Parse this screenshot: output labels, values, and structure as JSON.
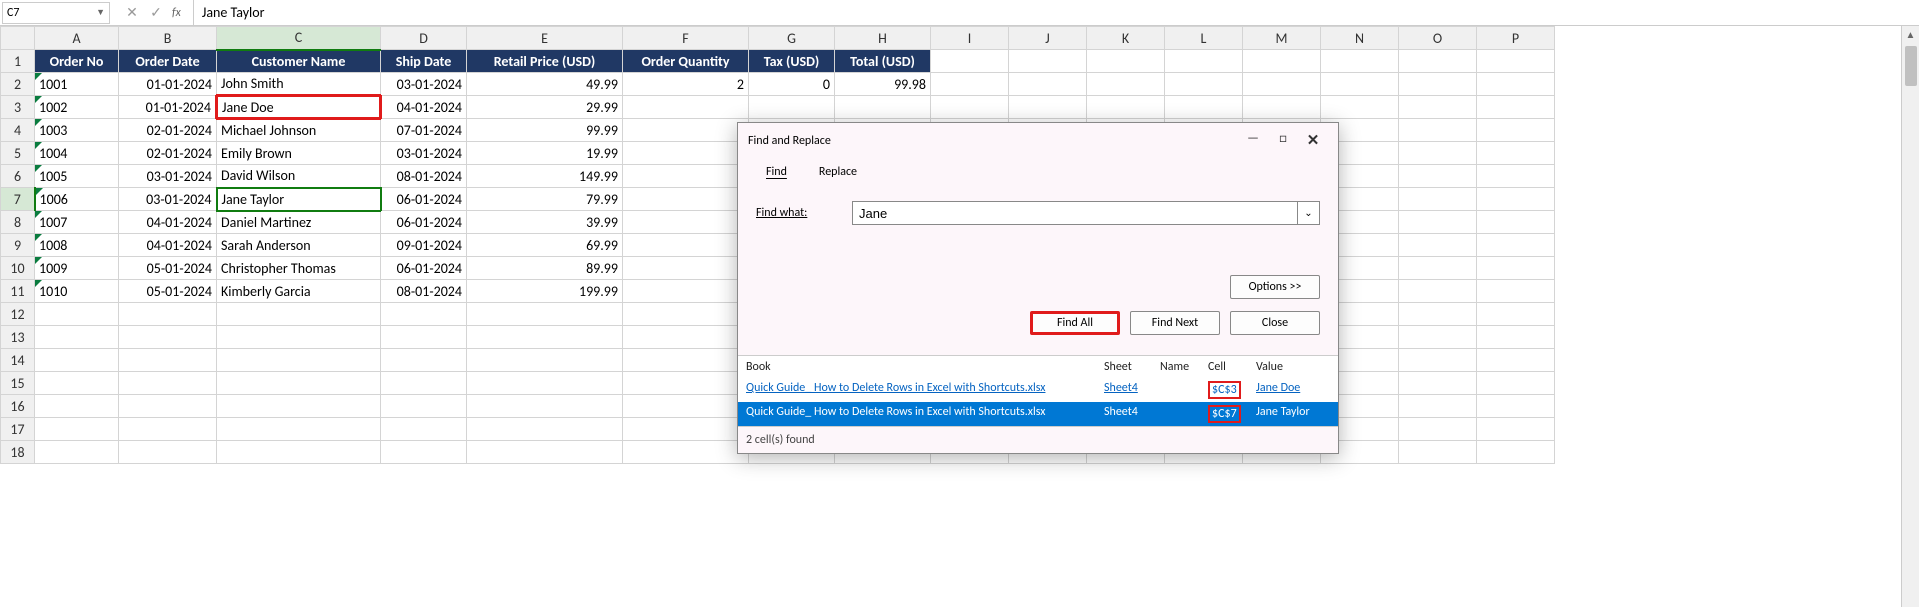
{
  "formula_bar": {
    "name_box": "C7",
    "cancel": "✕",
    "confirm": "✓",
    "fx": "fx",
    "content": "Jane Taylor"
  },
  "columns": [
    "A",
    "B",
    "C",
    "D",
    "E",
    "F",
    "G",
    "H",
    "I",
    "J",
    "K",
    "L",
    "M",
    "N",
    "O",
    "P"
  ],
  "row_numbers": [
    1,
    2,
    3,
    4,
    5,
    6,
    7,
    8,
    9,
    10,
    11,
    12,
    13,
    14,
    15,
    16,
    17,
    18
  ],
  "headers": [
    "Order No",
    "Order Date",
    "Customer Name",
    "Ship Date",
    "Retail Price (USD)",
    "Order Quantity",
    "Tax (USD)",
    "Total (USD)"
  ],
  "rows": [
    {
      "order_no": "1001",
      "order_date": "01-01-2024",
      "customer": "John Smith",
      "ship_date": "03-01-2024",
      "price": "49.99",
      "qty": "2",
      "tax": "0",
      "total": "99.98"
    },
    {
      "order_no": "1002",
      "order_date": "01-01-2024",
      "customer": "Jane Doe",
      "ship_date": "04-01-2024",
      "price": "29.99",
      "qty": "",
      "tax": "",
      "total": ""
    },
    {
      "order_no": "1003",
      "order_date": "02-01-2024",
      "customer": "Michael Johnson",
      "ship_date": "07-01-2024",
      "price": "99.99",
      "qty": "",
      "tax": "",
      "total": ""
    },
    {
      "order_no": "1004",
      "order_date": "02-01-2024",
      "customer": "Emily Brown",
      "ship_date": "03-01-2024",
      "price": "19.99",
      "qty": "",
      "tax": "",
      "total": ""
    },
    {
      "order_no": "1005",
      "order_date": "03-01-2024",
      "customer": "David Wilson",
      "ship_date": "08-01-2024",
      "price": "149.99",
      "qty": "",
      "tax": "",
      "total": ""
    },
    {
      "order_no": "1006",
      "order_date": "03-01-2024",
      "customer": "Jane Taylor",
      "ship_date": "06-01-2024",
      "price": "79.99",
      "qty": "",
      "tax": "",
      "total": ""
    },
    {
      "order_no": "1007",
      "order_date": "04-01-2024",
      "customer": "Daniel Martinez",
      "ship_date": "06-01-2024",
      "price": "39.99",
      "qty": "",
      "tax": "",
      "total": ""
    },
    {
      "order_no": "1008",
      "order_date": "04-01-2024",
      "customer": "Sarah Anderson",
      "ship_date": "09-01-2024",
      "price": "69.99",
      "qty": "",
      "tax": "",
      "total": ""
    },
    {
      "order_no": "1009",
      "order_date": "05-01-2024",
      "customer": "Christopher Thomas",
      "ship_date": "06-01-2024",
      "price": "89.99",
      "qty": "",
      "tax": "",
      "total": ""
    },
    {
      "order_no": "1010",
      "order_date": "05-01-2024",
      "customer": "Kimberly Garcia",
      "ship_date": "08-01-2024",
      "price": "199.99",
      "qty": "",
      "tax": "",
      "total": ""
    }
  ],
  "dialog": {
    "title": "Find and Replace",
    "tab_find": "Find",
    "tab_replace": "Replace",
    "find_what_label": "Find what:",
    "find_what_value": "Jane",
    "options_btn": "Options >>",
    "find_all_btn": "Find All",
    "find_next_btn": "Find Next",
    "close_btn": "Close",
    "results_headers": {
      "book": "Book",
      "sheet": "Sheet",
      "name": "Name",
      "cell": "Cell",
      "value": "Value"
    },
    "results": [
      {
        "book": "Quick Guide_ How to Delete Rows in Excel with Shortcuts.xlsx",
        "sheet": "Sheet4",
        "name": "",
        "cell": "$C$3",
        "value": "Jane Doe"
      },
      {
        "book": "Quick Guide_ How to Delete Rows in Excel with Shortcuts.xlsx",
        "sheet": "Sheet4",
        "name": "",
        "cell": "$C$7",
        "value": "Jane Taylor"
      }
    ],
    "status": "2 cell(s) found",
    "minimize_icon": "—",
    "maximize_icon": "□",
    "close_icon": "✕"
  },
  "active_cell": "C7",
  "highlighted_customers": [
    1,
    5
  ]
}
